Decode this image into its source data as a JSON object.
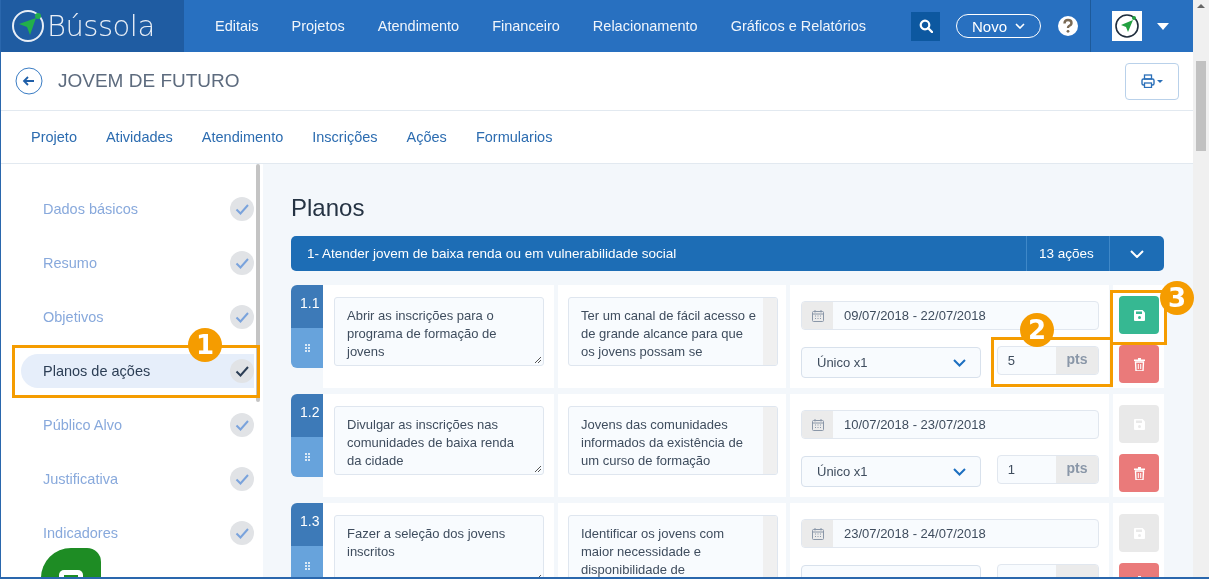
{
  "navbar": {
    "brand": "Bússola",
    "menu": [
      "Editais",
      "Projetos",
      "Atendimento",
      "Financeiro",
      "Relacionamento",
      "Gráficos e Relatórios"
    ],
    "new_button": "Novo"
  },
  "header": {
    "title": "JOVEM DE FUTURO"
  },
  "tabs": [
    "Projeto",
    "Atividades",
    "Atendimento",
    "Inscrições",
    "Ações",
    "Formularios"
  ],
  "sidebar": {
    "items": [
      {
        "label": "Dados básicos",
        "selected": false
      },
      {
        "label": "Resumo",
        "selected": false
      },
      {
        "label": "Objetivos",
        "selected": false
      },
      {
        "label": "Planos de ações",
        "selected": true
      },
      {
        "label": "Público Alvo",
        "selected": false
      },
      {
        "label": "Justificativa",
        "selected": false
      },
      {
        "label": "Indicadores",
        "selected": false
      }
    ]
  },
  "content": {
    "title": "Planos",
    "plan": {
      "title": "1- Atender jovem de baixa renda ou em vulnerabilidade social",
      "count": "13 ações",
      "actions": [
        {
          "number": "1.1",
          "description": "Abrir as inscrições para o programa de formação de jovens",
          "result": "Ter um canal de fácil acesso e de grande alcance para que os jovens possam se",
          "period": "09/07/2018 - 22/07/2018",
          "frequency": "Único x1",
          "points": "5",
          "points_unit": "pts",
          "save_disabled": false
        },
        {
          "number": "1.2",
          "description": "Divulgar as inscrições nas comunidades de baixa renda da cidade",
          "result": "Jovens das comunidades informados da existência de um curso de formação",
          "period": "10/07/2018 - 23/07/2018",
          "frequency": "Único x1",
          "points": "1",
          "points_unit": "pts",
          "save_disabled": true
        },
        {
          "number": "1.3",
          "description": "Fazer a seleção dos jovens inscritos",
          "result": "Identificar os jovens com maior necessidade e disponibilidade de",
          "period": "23/07/2018 - 24/07/2018",
          "save_disabled": true
        }
      ]
    }
  },
  "callouts": [
    {
      "number": "1"
    },
    {
      "number": "2"
    },
    {
      "number": "3"
    }
  ]
}
